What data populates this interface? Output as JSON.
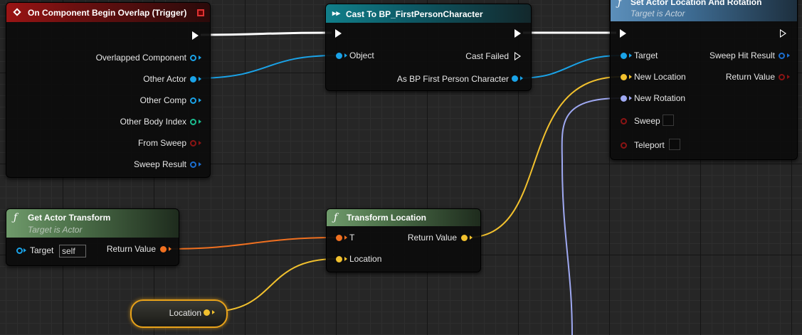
{
  "colors": {
    "exec": "#ffffff",
    "object": "#1aa3e8",
    "vector": "#f2c12e",
    "rotator": "#9fa9f2",
    "transform": "#f07020",
    "bool": "#8b1414",
    "struct": "#1c6fd1",
    "int": "#1bbc8f"
  },
  "nodes": {
    "overlap": {
      "title": "On Component Begin Overlap (Trigger)",
      "pins": {
        "overlapped_component": "Overlapped Component",
        "other_actor": "Other Actor",
        "other_comp": "Other Comp",
        "other_body_index": "Other Body Index",
        "from_sweep": "From Sweep",
        "sweep_result": "Sweep Result"
      }
    },
    "cast": {
      "title": "Cast To BP_FirstPersonCharacter",
      "pins": {
        "object": "Object",
        "cast_failed": "Cast Failed",
        "as_bp": "As BP First Person Character"
      }
    },
    "setactor": {
      "title": "Set Actor Location And Rotation",
      "subtitle": "Target is Actor",
      "pins": {
        "target": "Target",
        "new_location": "New Location",
        "new_rotation": "New Rotation",
        "sweep": "Sweep",
        "teleport": "Teleport",
        "sweep_hit_result": "Sweep Hit Result",
        "return_value": "Return Value"
      }
    },
    "getxform": {
      "title": "Get Actor Transform",
      "subtitle": "Target is Actor",
      "pins": {
        "target": "Target",
        "target_default": "self",
        "return_value": "Return Value"
      }
    },
    "xformloc": {
      "title": "Transform Location",
      "pins": {
        "t": "T",
        "location": "Location",
        "return_value": "Return Value"
      }
    },
    "locvar": {
      "label": "Location"
    }
  }
}
